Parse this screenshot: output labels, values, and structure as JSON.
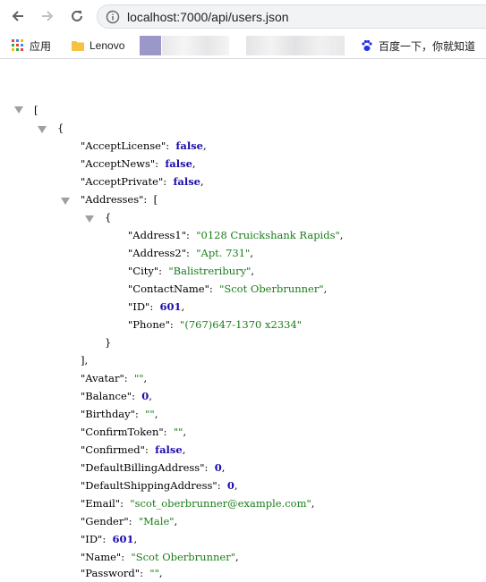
{
  "browser": {
    "url": "localhost:7000/api/users.json",
    "bookmarks": {
      "apps_label": "应用",
      "lenovo_label": "Lenovo",
      "baidu_label": "百度一下，你就知道"
    }
  },
  "json_view": {
    "open_bracket": "[",
    "object_open": "{",
    "fields_before": [
      {
        "key": "\"AcceptLicense\":",
        "value": "false",
        "type": "bool"
      },
      {
        "key": "\"AcceptNews\":",
        "value": "false",
        "type": "bool"
      },
      {
        "key": "\"AcceptPrivate\":",
        "value": "false",
        "type": "bool"
      }
    ],
    "addresses_key": "\"Addresses\":",
    "addresses_open": "[",
    "address_object_open": "{",
    "address_fields": [
      {
        "key": "\"Address1\":",
        "value": "\"0128 Cruickshank Rapids\"",
        "type": "str",
        "comma": true
      },
      {
        "key": "\"Address2\":",
        "value": "\"Apt. 731\"",
        "type": "str",
        "comma": true
      },
      {
        "key": "\"City\":",
        "value": "\"Balistreribury\"",
        "type": "str",
        "comma": true
      },
      {
        "key": "\"ContactName\":",
        "value": "\"Scot Oberbrunner\"",
        "type": "str",
        "comma": true
      },
      {
        "key": "\"ID\":",
        "value": "601",
        "type": "num",
        "comma": true
      },
      {
        "key": "\"Phone\":",
        "value": "\"(767)647-1370 x2334\"",
        "type": "str",
        "comma": false
      }
    ],
    "address_object_close": "}",
    "addresses_close": "],",
    "fields_after": [
      {
        "key": "\"Avatar\":",
        "value": "\"\"",
        "type": "str"
      },
      {
        "key": "\"Balance\":",
        "value": "0",
        "type": "num"
      },
      {
        "key": "\"Birthday\":",
        "value": "\"\"",
        "type": "str"
      },
      {
        "key": "\"ConfirmToken\":",
        "value": "\"\"",
        "type": "str"
      },
      {
        "key": "\"Confirmed\":",
        "value": "false",
        "type": "bool"
      },
      {
        "key": "\"DefaultBillingAddress\":",
        "value": "0",
        "type": "num"
      },
      {
        "key": "\"DefaultShippingAddress\":",
        "value": "0",
        "type": "num"
      },
      {
        "key": "\"Email\":",
        "value": "\"scot_oberbrunner@example.com\"",
        "type": "str"
      },
      {
        "key": "\"Gender\":",
        "value": "\"Male\"",
        "type": "str"
      },
      {
        "key": "\"ID\":",
        "value": "601",
        "type": "num"
      },
      {
        "key": "\"Name\":",
        "value": "\"Scot Oberbrunner\"",
        "type": "str"
      },
      {
        "key": "\"Password\":",
        "value": "\"\"",
        "type": "str"
      }
    ]
  }
}
